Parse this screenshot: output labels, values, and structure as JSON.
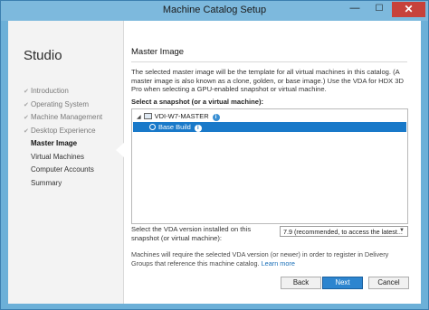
{
  "window": {
    "title": "Machine Catalog Setup",
    "minimize_glyph": "—",
    "maximize_glyph": "☐",
    "close_glyph": "✕"
  },
  "sidebar": {
    "brand": "Studio",
    "check_glyph": "✔",
    "items": [
      {
        "label": "Introduction",
        "state": "done"
      },
      {
        "label": "Operating System",
        "state": "done"
      },
      {
        "label": "Machine Management",
        "state": "done"
      },
      {
        "label": "Desktop Experience",
        "state": "done"
      },
      {
        "label": "Master Image",
        "state": "current"
      },
      {
        "label": "Virtual Machines",
        "state": "todo"
      },
      {
        "label": "Computer Accounts",
        "state": "todo"
      },
      {
        "label": "Summary",
        "state": "todo"
      }
    ]
  },
  "main": {
    "heading": "Master Image",
    "description": "The selected master image will be the template for all virtual machines in this catalog. (A master image is also known as a clone, golden, or base image.) Use the VDA for HDX 3D Pro when selecting a GPU-enabled snapshot or virtual machine.",
    "select_label": "Select a snapshot (or a virtual machine):",
    "tree": {
      "vm_name": "VDI-W7-MASTER",
      "snapshot_name": "Base Build",
      "info_glyph": "i",
      "expand_glyph": "◢"
    },
    "vda_label": "Select the VDA version installed on this snapshot (or virtual machine):",
    "vda_value": "7.9 (recommended, to access the latest...",
    "dropdown_glyph": "▼",
    "note_text": "Machines will require the selected VDA version (or newer) in order to register in Delivery Groups that reference this machine catalog. ",
    "note_link": "Learn more"
  },
  "buttons": {
    "back": "Back",
    "next": "Next",
    "cancel": "Cancel"
  },
  "colors": {
    "accent": "#1979c9",
    "titlebar": "#7db9dd",
    "close": "#c7423b"
  }
}
